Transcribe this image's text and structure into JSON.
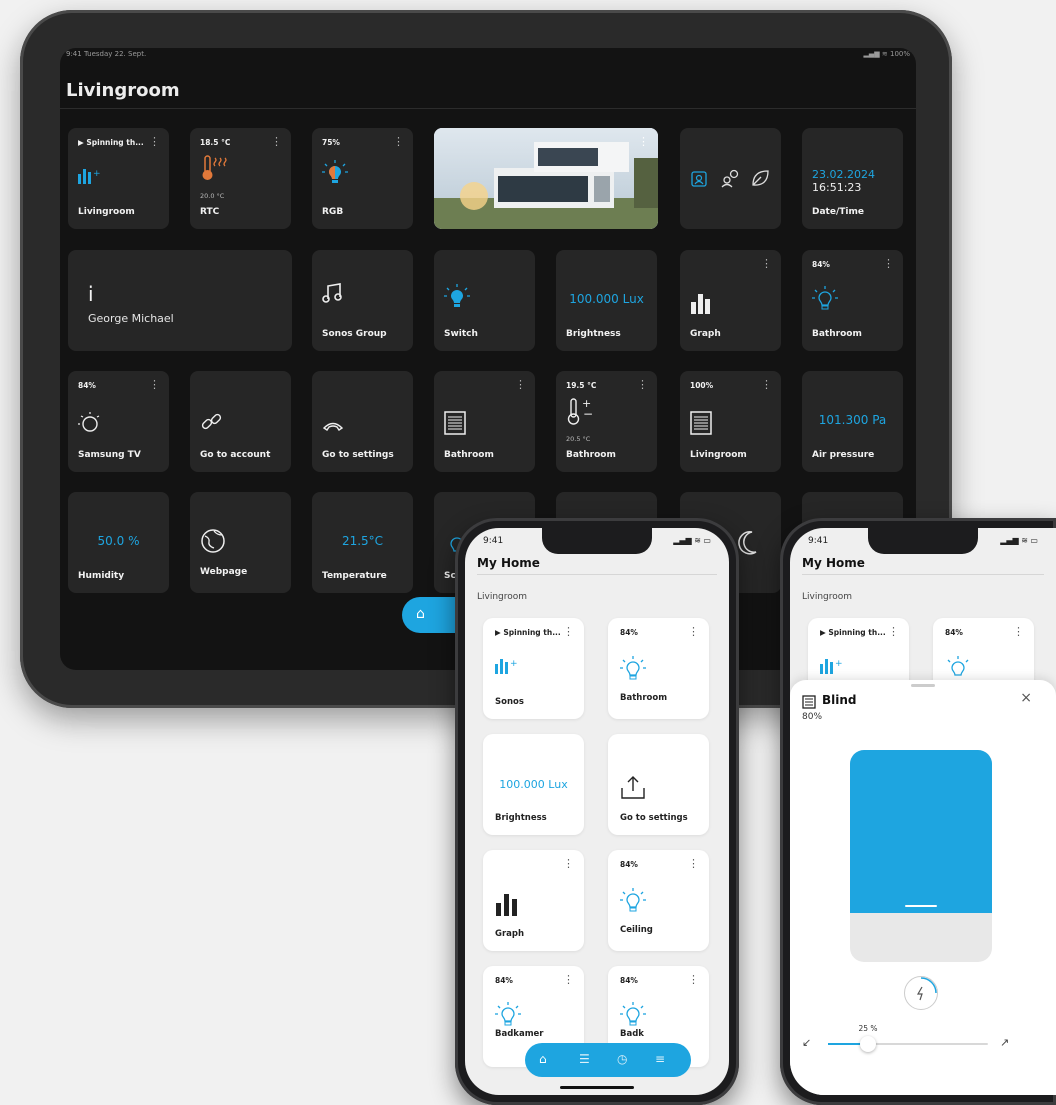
{
  "tablet": {
    "status_time": "9:41 Tuesday 22. Sept.",
    "status_right": "100%",
    "title": "Livingroom",
    "tiles": {
      "sonos": {
        "top": "▶ Spinning th...",
        "name": "Livingroom"
      },
      "rtc": {
        "top": "18.5 °C",
        "sub": "20.0 °C",
        "name": "RTC"
      },
      "rgb": {
        "top": "75%",
        "name": "RGB"
      },
      "datetime": {
        "date": "23.02.2024",
        "time": "16:51:23",
        "name": "Date/Time"
      },
      "info": {
        "glyph": "i",
        "name": "George Michael"
      },
      "sonos_group": {
        "name": "Sonos Group"
      },
      "switch": {
        "name": "Switch"
      },
      "brightness": {
        "value": "100.000 Lux",
        "name": "Brightness"
      },
      "graph": {
        "name": "Graph"
      },
      "bathroom_light": {
        "top": "84%",
        "name": "Bathroom"
      },
      "samsung": {
        "top": "84%",
        "name": "Samsung TV"
      },
      "account": {
        "name": "Go to account"
      },
      "settings": {
        "name": "Go to settings"
      },
      "bath_blind": {
        "name": "Bathroom"
      },
      "bath_temp": {
        "top": "19.5 °C",
        "sub": "20.5 °C",
        "name": "Bathroom"
      },
      "living_blind": {
        "top": "100%",
        "name": "Livingroom"
      },
      "pressure": {
        "value": "101.300 Pa",
        "name": "Air pressure"
      },
      "humidity": {
        "value": "50.0 %",
        "name": "Humidity"
      },
      "webpage": {
        "name": "Webpage"
      },
      "temperature": {
        "value": "21.5°C",
        "name": "Temperature"
      },
      "partial_scene": {
        "name": "Sc"
      }
    }
  },
  "phone1": {
    "time": "9:41",
    "title": "My Home",
    "section": "Livingroom",
    "tiles": {
      "sonos": {
        "top": "▶ Spinning th...",
        "name": "Sonos"
      },
      "bathroom": {
        "top": "84%",
        "name": "Bathroom"
      },
      "brightness": {
        "value": "100.000 Lux",
        "name": "Brightness"
      },
      "settings": {
        "name": "Go to settings"
      },
      "graph": {
        "name": "Graph"
      },
      "ceiling": {
        "top": "84%",
        "name": "Ceiling"
      },
      "badkamer": {
        "top": "84%",
        "name": "Badkamer"
      },
      "light6": {
        "top": "84%",
        "name": "Badk"
      }
    }
  },
  "phone2": {
    "time": "9:41",
    "title": "My Home",
    "section": "Livingroom",
    "bg_tiles": {
      "sonos_top": "▶ Spinning th...",
      "light_top": "84%"
    },
    "sheet": {
      "title": "Blind",
      "value": "80%",
      "position_percent": 80,
      "slider_label": "25 %",
      "slider_value": 25
    }
  },
  "colors": {
    "accent": "#1ea5e0",
    "tile_dark": "#262626",
    "screen_dark": "#131313",
    "phone_bg": "#efefef"
  }
}
